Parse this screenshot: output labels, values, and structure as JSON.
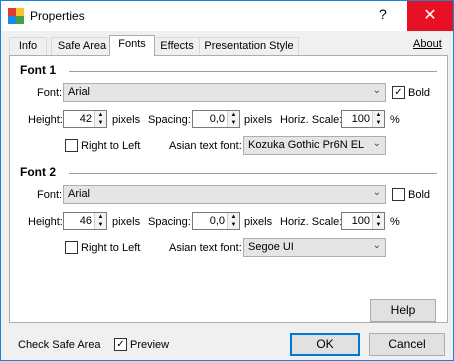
{
  "window": {
    "title": "Properties",
    "help_glyph": "?",
    "close_glyph": "✕"
  },
  "tabs": [
    {
      "label": "Info"
    },
    {
      "label": "Safe Area"
    },
    {
      "label": "Fonts"
    },
    {
      "label": "Effects"
    },
    {
      "label": "Presentation Style"
    }
  ],
  "active_tab": "Fonts",
  "about_link": "About",
  "font1": {
    "title": "Font 1",
    "font_label": "Font:",
    "font_value": "Arial",
    "bold_label": "Bold",
    "bold_checked": true,
    "height_label": "Height:",
    "height_value": "42",
    "height_unit": "pixels",
    "spacing_label": "Spacing:",
    "spacing_value": "0,0",
    "spacing_unit": "pixels",
    "hscale_label": "Horiz. Scale:",
    "hscale_value": "100",
    "hscale_unit": "%",
    "rtl_label": "Right to Left",
    "rtl_checked": false,
    "asian_label": "Asian text font:",
    "asian_value": "Kozuka Gothic Pr6N EL"
  },
  "font2": {
    "title": "Font 2",
    "font_label": "Font:",
    "font_value": "Arial",
    "bold_label": "Bold",
    "bold_checked": false,
    "height_label": "Height:",
    "height_value": "46",
    "height_unit": "pixels",
    "spacing_label": "Spacing:",
    "spacing_value": "0,0",
    "spacing_unit": "pixels",
    "hscale_label": "Horiz. Scale:",
    "hscale_value": "100",
    "hscale_unit": "%",
    "rtl_label": "Right to Left",
    "rtl_checked": false,
    "asian_label": "Asian text font:",
    "asian_value": "Segoe UI"
  },
  "help_button": "Help",
  "footer": {
    "check_safe_area": "Check Safe Area",
    "preview_label": "Preview",
    "preview_checked": true,
    "ok": "OK",
    "cancel": "Cancel"
  },
  "colors": {
    "accent": "#0078d7",
    "close_red": "#e81123",
    "dialog_bg": "#f0f0f0"
  },
  "icons": {
    "app": "properties-app-icon",
    "checkmark": "✓",
    "dropdown": "⌄",
    "spin_up": "▲",
    "spin_down": "▼"
  }
}
